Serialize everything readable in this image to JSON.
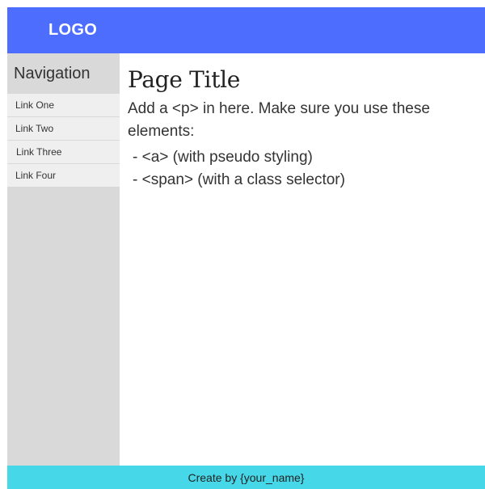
{
  "header": {
    "logo": "LOGO"
  },
  "sidebar": {
    "heading": "Navigation",
    "items": [
      {
        "label": "Link One"
      },
      {
        "label": "Link Two"
      },
      {
        "label": "Link Three"
      },
      {
        "label": "Link Four"
      }
    ]
  },
  "main": {
    "title": "Page Title",
    "intro": "Add a <p> in here. Make sure you use these elements:",
    "bullets": [
      "- <a> (with pseudo styling)",
      "- <span> (with a class selector)"
    ]
  },
  "footer": {
    "text": "Create by {your_name}"
  },
  "colors": {
    "header_bg": "#4d6dff",
    "sidebar_bg": "#d9d9d9",
    "nav_item_bg": "#efefef",
    "footer_bg": "#46d8e8"
  }
}
